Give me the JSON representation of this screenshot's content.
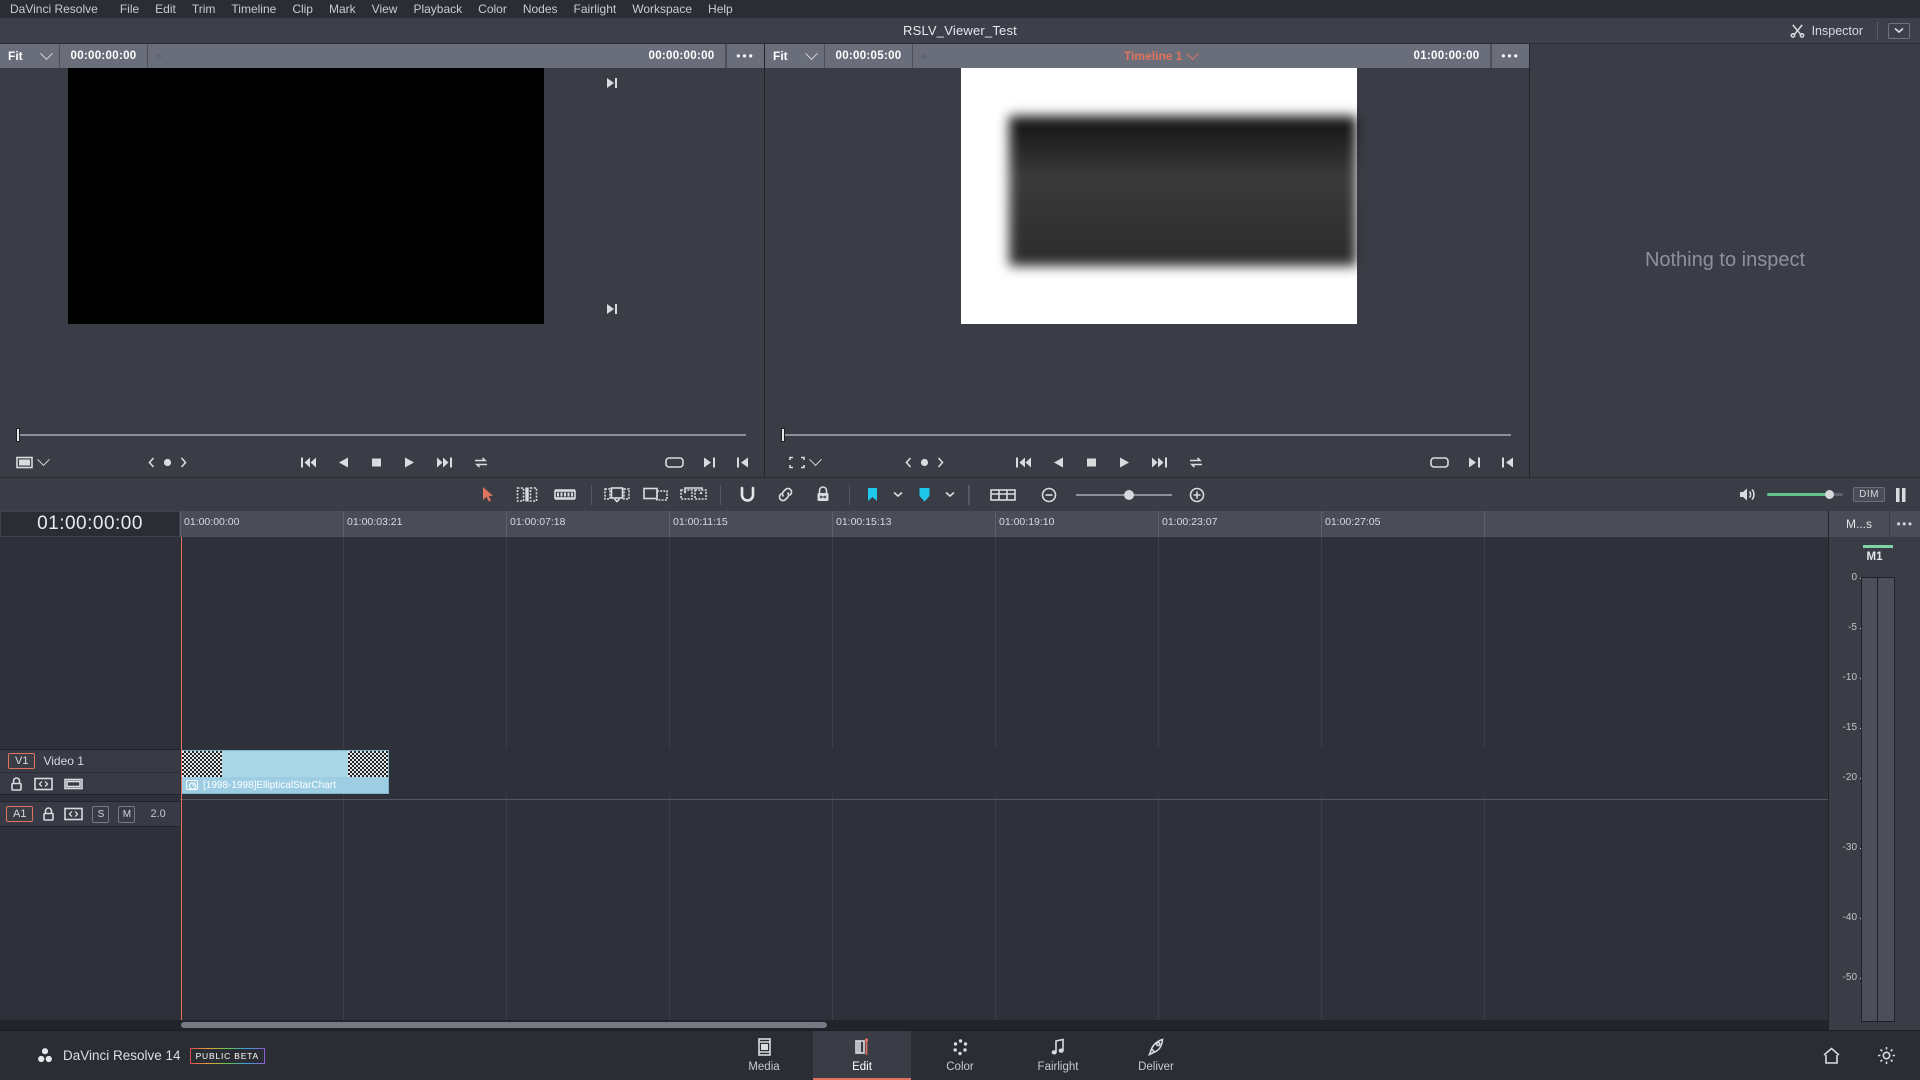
{
  "menubar": {
    "items": [
      {
        "label": "DaVinci Resolve"
      },
      {
        "label": "File"
      },
      {
        "label": "Edit"
      },
      {
        "label": "Trim"
      },
      {
        "label": "Timeline"
      },
      {
        "label": "Clip"
      },
      {
        "label": "Mark"
      },
      {
        "label": "View"
      },
      {
        "label": "Playback"
      },
      {
        "label": "Color"
      },
      {
        "label": "Nodes"
      },
      {
        "label": "Fairlight"
      },
      {
        "label": "Workspace"
      },
      {
        "label": "Help"
      }
    ]
  },
  "titlebar": {
    "title": "RSLV_Viewer_Test",
    "inspector_label": "Inspector",
    "inspector_icon": "scissors-icon",
    "caret_icon": "chevron-down-icon"
  },
  "source_viewer": {
    "zoom_mode": "Fit",
    "timecode_left": "00:00:00:00",
    "timecode_right": "00:00:00:00",
    "overflow_label": "•••",
    "marker_glyph": "○"
  },
  "timeline_viewer": {
    "zoom_mode": "Fit",
    "timecode_left": "00:00:05:00",
    "timeline_name": "Timeline 1",
    "timecode_right": "01:00:00:00",
    "overflow_label": "•••",
    "marker_glyph": "○",
    "name_color": "#e0735e"
  },
  "inspector": {
    "empty_message": "Nothing to inspect"
  },
  "timeline_toolbar": {
    "tools": [
      {
        "name": "selection-arrow-icon",
        "active": true
      },
      {
        "name": "trim-edit-icon",
        "active": false
      },
      {
        "name": "dynamic-trim-icon",
        "active": false
      },
      {
        "name": "blade-razor-icon",
        "active": false
      },
      {
        "name": "insert-clip-icon",
        "active": false
      },
      {
        "name": "swap-clip-icon",
        "active": false
      },
      {
        "name": "snapping-magnet-icon",
        "active": false
      },
      {
        "name": "link-clips-icon",
        "active": false
      },
      {
        "name": "lock-track-icon",
        "active": false
      },
      {
        "name": "flag-icon",
        "active": false
      },
      {
        "name": "marker-icon",
        "active": false
      },
      {
        "name": "timeline-view-options-icon",
        "active": false
      }
    ],
    "zoom_out_label": "−",
    "zoom_in_label": "+",
    "dim_label": "DIM",
    "speaker_icon": "volume-icon",
    "audio_meter_toggle_icon": "meter-bars-icon"
  },
  "timeline": {
    "current_timecode": "01:00:00:00",
    "ruler_labels": [
      "01:00:00:00",
      "01:00:03:21",
      "01:00:07:18",
      "01:00:11:15",
      "01:00:15:13",
      "01:00:19:10",
      "01:00:23:07",
      "01:00:27:05"
    ],
    "video_track": {
      "id": "V1",
      "name": "Video 1",
      "lock_icon": "lock-icon",
      "link_icon": "auto-select-icon",
      "thumbnail_icon": "filmstrip-icon"
    },
    "audio_track": {
      "id": "A1",
      "lock_icon": "lock-icon",
      "link_icon": "auto-select-icon",
      "solo_label": "S",
      "mute_label": "M",
      "channels": "2.0"
    },
    "clip": {
      "name": "[1998-1998]EllipticalStarChart",
      "icon": "speed-gauge-icon",
      "color": "#aad6e8"
    }
  },
  "audio_meter": {
    "panel_title": "M...s",
    "overflow_label": "•••",
    "channel_label": "M1",
    "scale": [
      "0",
      "-5",
      "-10",
      "-15",
      "-20",
      "-30",
      "-40",
      "-50"
    ]
  },
  "bottombar": {
    "app_name": "DaVinci Resolve 14",
    "beta_badge": "PUBLIC BETA",
    "logo_icon": "resolve-logo-icon",
    "pages": [
      {
        "label": "Media",
        "icon": "media-icon",
        "active": false
      },
      {
        "label": "Edit",
        "icon": "edit-icon",
        "active": true
      },
      {
        "label": "Color",
        "icon": "color-icon",
        "active": false
      },
      {
        "label": "Fairlight",
        "icon": "fairlight-note-icon",
        "active": false
      },
      {
        "label": "Deliver",
        "icon": "deliver-rocket-icon",
        "active": false
      }
    ],
    "home_icon": "home-icon",
    "settings_icon": "gear-icon"
  }
}
